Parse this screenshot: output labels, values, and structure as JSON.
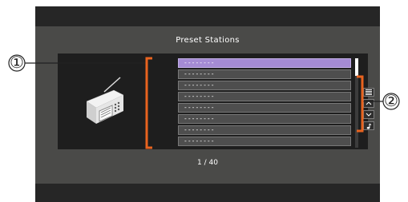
{
  "screen": {
    "title": "Preset Stations",
    "presets": [
      {
        "label": "--------",
        "selected": true
      },
      {
        "label": "--------",
        "selected": false
      },
      {
        "label": "--------",
        "selected": false
      },
      {
        "label": "--------",
        "selected": false
      },
      {
        "label": "--------",
        "selected": false
      },
      {
        "label": "--------",
        "selected": false
      },
      {
        "label": "--------",
        "selected": false
      },
      {
        "label": "--------",
        "selected": false
      }
    ],
    "page_indicator": "1 / 40",
    "side_buttons": [
      "list-icon",
      "chevron-up-icon",
      "chevron-down-icon",
      "music-note-icon"
    ],
    "selected_color": "#a48bd4"
  },
  "callouts": {
    "one": "①",
    "two": "②"
  }
}
